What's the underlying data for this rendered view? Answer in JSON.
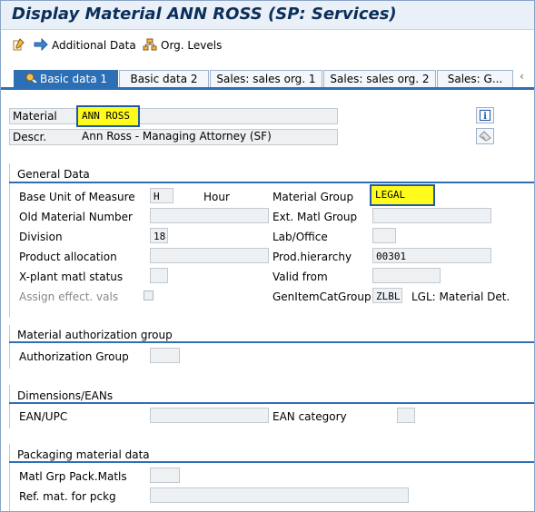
{
  "window": {
    "title": "Display Material ANN ROSS (SP: Services)"
  },
  "toolbar": {
    "additional_data": "Additional Data",
    "org_levels": "Org. Levels"
  },
  "tabs": [
    {
      "label": "Basic data 1",
      "active": true
    },
    {
      "label": "Basic data 2",
      "active": false
    },
    {
      "label": "Sales: sales org. 1",
      "active": false
    },
    {
      "label": "Sales: sales org. 2",
      "active": false
    },
    {
      "label": "Sales: G...",
      "active": false
    }
  ],
  "header": {
    "material_label": "Material",
    "material_value": "ANN ROSS",
    "descr_label": "Descr.",
    "descr_value": "Ann Ross - Managing Attorney (SF)"
  },
  "general": {
    "title": "General Data",
    "base_uom_label": "Base Unit of Measure",
    "base_uom_value": "H",
    "base_uom_text": "Hour",
    "matl_group_label": "Material Group",
    "matl_group_value": "LEGAL",
    "old_matl_label": "Old Material Number",
    "old_matl_value": "",
    "ext_matl_group_label": "Ext. Matl Group",
    "ext_matl_group_value": "",
    "division_label": "Division",
    "division_value": "18",
    "lab_office_label": "Lab/Office",
    "lab_office_value": "",
    "product_alloc_label": "Product allocation",
    "product_alloc_value": "",
    "prod_hier_label": "Prod.hierarchy",
    "prod_hier_value": "00301",
    "xplant_label": "X-plant matl status",
    "xplant_value": "",
    "valid_from_label": "Valid from",
    "valid_from_value": "",
    "assign_eff_label": "Assign effect. vals",
    "assign_eff_checked": false,
    "gen_item_cat_label": "GenItemCatGroup",
    "gen_item_cat_value": "ZLBL",
    "gen_item_cat_text": "LGL: Material Det."
  },
  "auth": {
    "title": "Material authorization group",
    "auth_group_label": "Authorization Group",
    "auth_group_value": ""
  },
  "dims": {
    "title": "Dimensions/EANs",
    "ean_upc_label": "EAN/UPC",
    "ean_upc_value": "",
    "ean_cat_label": "EAN category",
    "ean_cat_value": ""
  },
  "packaging": {
    "title": "Packaging material data",
    "matl_grp_pack_label": "Matl Grp Pack.Matls",
    "matl_grp_pack_value": "",
    "ref_mat_label": "Ref. mat. for pckg",
    "ref_mat_value": ""
  },
  "colors": {
    "accent": "#2c6fb5",
    "highlight": "#fffb1c",
    "title": "#0b2e5b"
  },
  "icons": [
    "additional-data-icon",
    "org-levels-icon",
    "tab-overview-icon",
    "info-icon",
    "other-icon"
  ]
}
